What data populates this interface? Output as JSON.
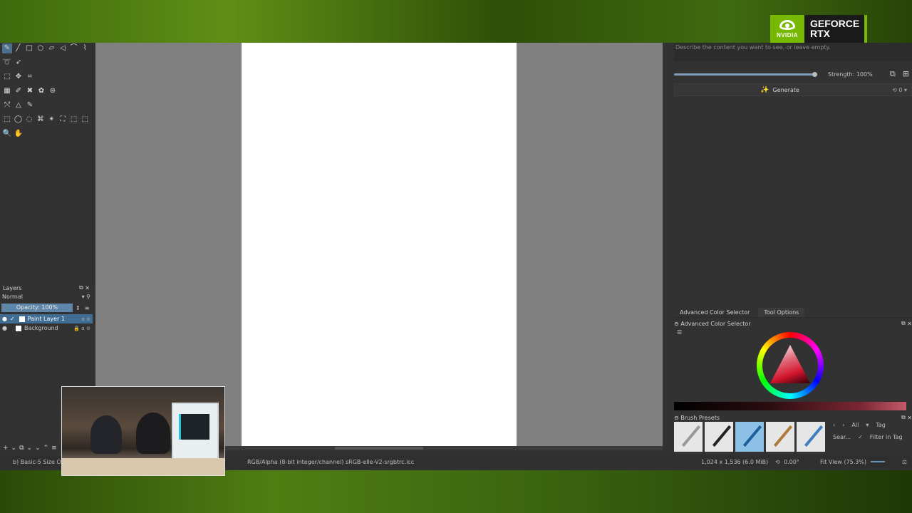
{
  "branding": {
    "logo_word": "NVIDIA",
    "title": "GEFORCE RTX"
  },
  "toolbox": {
    "rows": [
      [
        "✎",
        "╱",
        "□",
        "○",
        "▱",
        "◁",
        "⌒",
        "⌇"
      ],
      [
        "➰",
        "➶"
      ],
      [
        "⬚",
        "✥",
        "⌗"
      ],
      [
        "▦",
        "✐",
        "✖",
        "✿",
        "⊛"
      ],
      [
        "⤲",
        "△",
        "✎"
      ],
      [
        "⬚",
        "◯",
        "◌",
        "⌘",
        "✴",
        "⛶",
        "⬚",
        "⬚"
      ],
      [
        "🔍",
        "✋"
      ]
    ]
  },
  "layers": {
    "title": "Layers",
    "blend_mode": "Normal",
    "opacity": "Opacity: 100%",
    "items": [
      {
        "name": "Paint Layer 1",
        "selected": true
      },
      {
        "name": "Background",
        "selected": false
      }
    ]
  },
  "ai_panel": {
    "prompt_placeholder": "Describe the content you want to see, or leave empty.",
    "strength": "Strength: 100%",
    "strength_fraction": 1.0,
    "generate_label": "Generate",
    "queue_count": "0"
  },
  "docker_tabs": [
    "Advanced Color Selector",
    "Tool Options"
  ],
  "color_panel": {
    "title": "Advanced Color Selector"
  },
  "brush_presets": {
    "title": "Brush Presets",
    "filter": "All",
    "tag": "Tag",
    "search_placeholder": "Sear...",
    "filter_in_tag": "Filter in Tag"
  },
  "status": {
    "brush": "b) Basic-5 Size O",
    "color_info": "RGB/Alpha (8-bit integer/channel)  sRGB-elle-V2-srgbtrc.icc",
    "dimensions": "1,024 x 1,536 (6.0 MiB)",
    "rotation": "0.00°",
    "zoom": "Fit View (75.3%)"
  }
}
